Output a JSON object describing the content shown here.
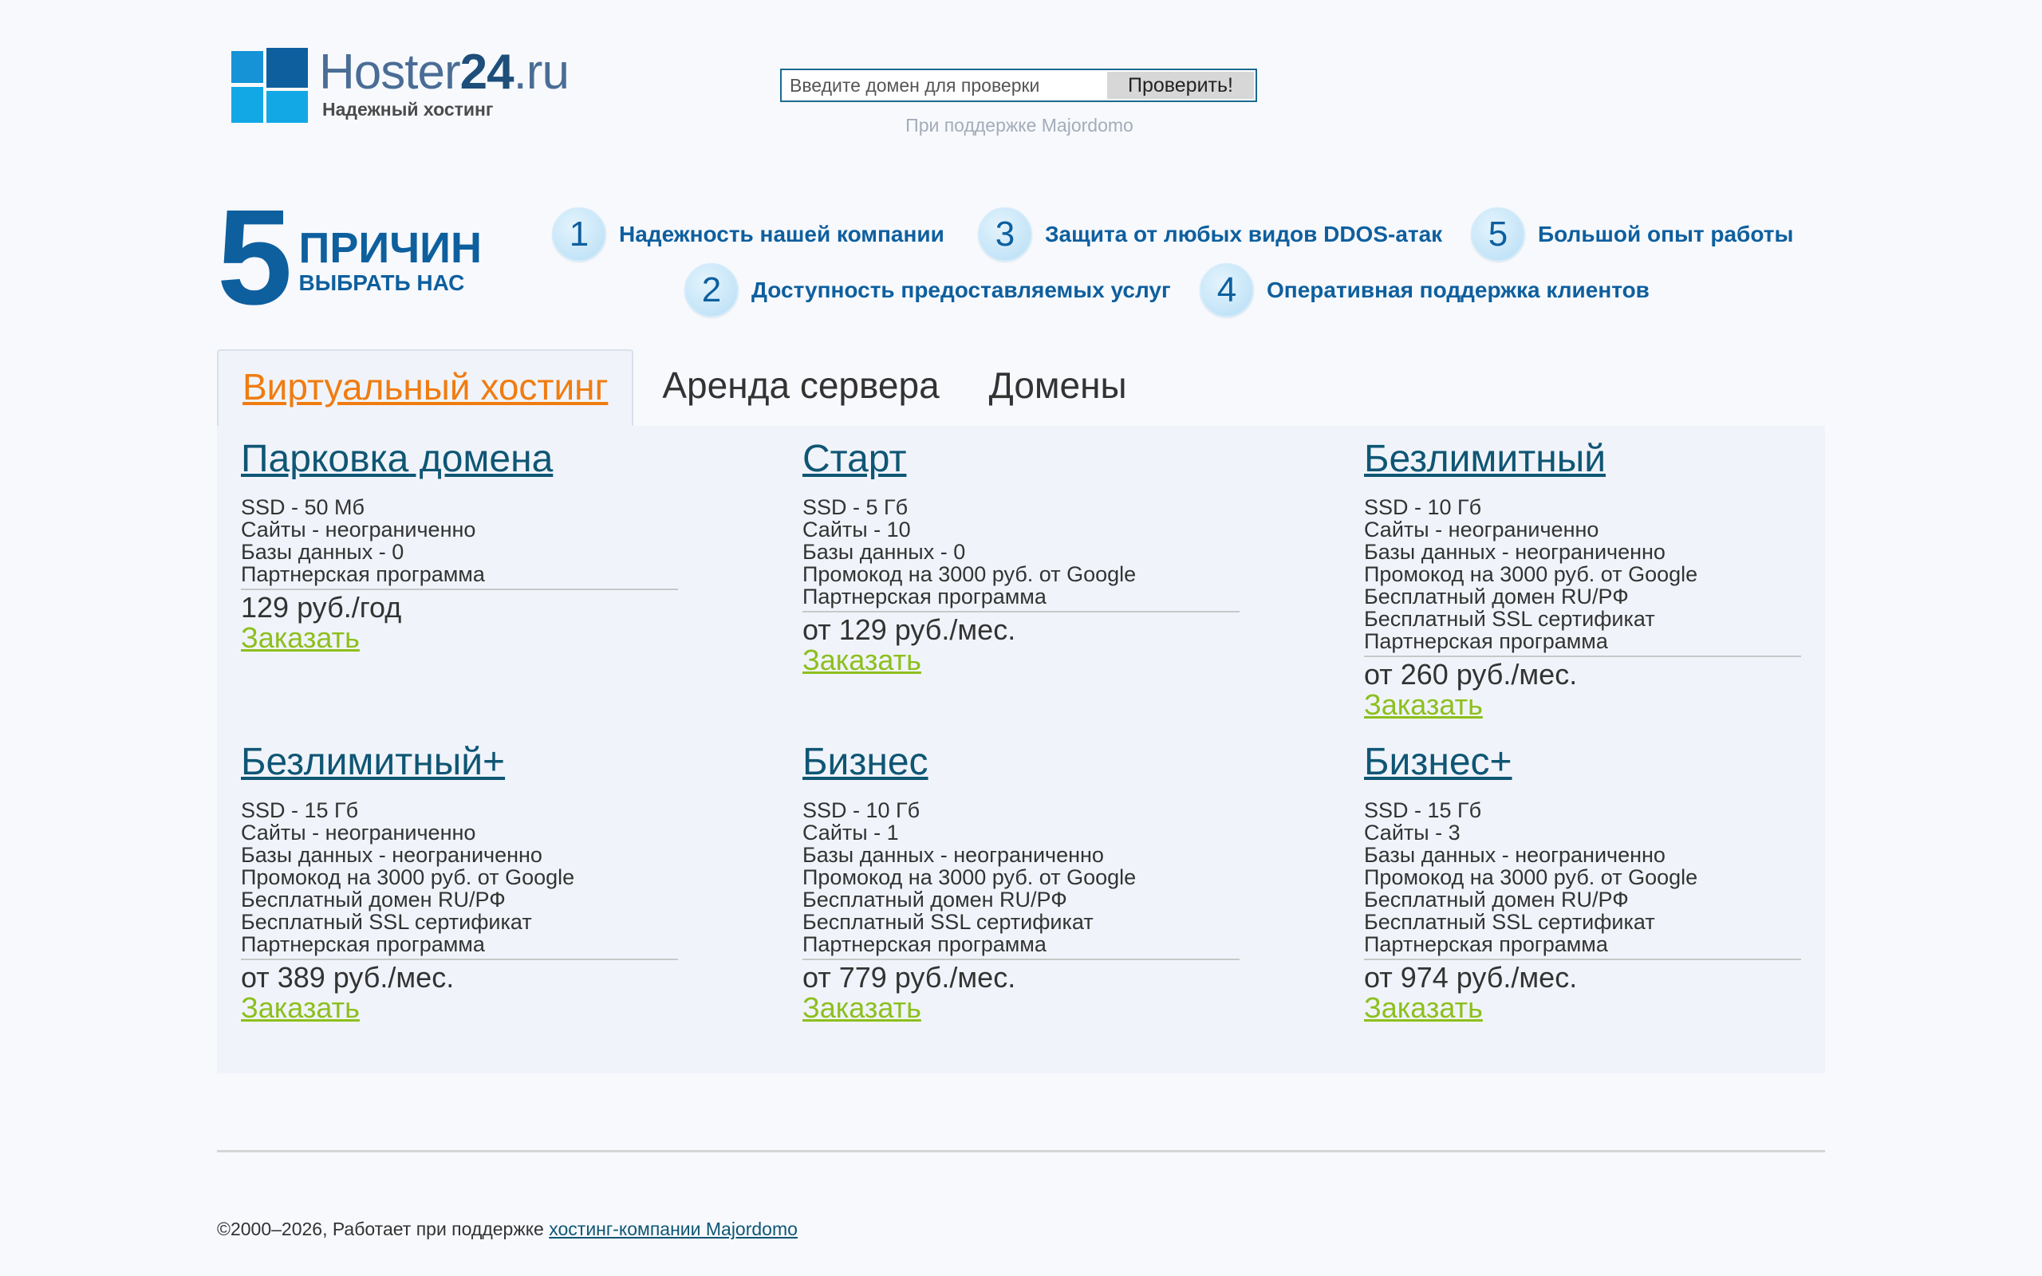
{
  "header": {
    "logo_name": "Hoster",
    "logo_num": "24",
    "logo_tld": ".ru",
    "logo_tagline": "Надежный хостинг",
    "search_placeholder": "Введите домен для проверки",
    "search_button": "Проверить!",
    "support_note": "При поддержке Majordomo"
  },
  "reasons": {
    "big_number": "5",
    "title_line1": "ПРИЧИН",
    "title_line2": "ВЫБРАТЬ НАС",
    "items": [
      {
        "num": "1",
        "text": "Надежность нашей компании"
      },
      {
        "num": "2",
        "text": "Доступность предоставляемых услуг"
      },
      {
        "num": "3",
        "text": "Защита от любых видов DDOS-атак"
      },
      {
        "num": "4",
        "text": "Оперативная поддержка клиентов"
      },
      {
        "num": "5",
        "text": "Большой опыт работы"
      }
    ]
  },
  "tabs": [
    {
      "label": "Виртуальный хостинг",
      "active": true
    },
    {
      "label": "Аренда сервера",
      "active": false
    },
    {
      "label": "Домены",
      "active": false
    }
  ],
  "plans": [
    {
      "name": "Парковка домена",
      "features": [
        "SSD - 50 Мб",
        "Сайты - неограниченно",
        "Базы данных - 0",
        "Партнерская программа"
      ],
      "price": "129 руб./год",
      "order": "Заказать"
    },
    {
      "name": "Старт",
      "features": [
        "SSD - 5 Гб",
        "Сайты - 10",
        "Базы данных - 0",
        "Промокод на 3000 руб. от Google",
        "Партнерская программа"
      ],
      "price": "от 129 руб./мес.",
      "order": "Заказать"
    },
    {
      "name": "Безлимитный",
      "features": [
        "SSD - 10 Гб",
        "Сайты - неограниченно",
        "Базы данных - неограниченно",
        "Промокод на 3000 руб. от Google",
        "Бесплатный домен RU/РФ",
        "Бесплатный SSL сертификат",
        "Партнерская программа"
      ],
      "price": "от 260 руб./мес.",
      "order": "Заказать"
    },
    {
      "name": "Безлимитный+",
      "features": [
        "SSD - 15 Гб",
        "Сайты - неограниченно",
        "Базы данных - неограниченно",
        "Промокод на 3000 руб. от Google",
        "Бесплатный домен RU/РФ",
        "Бесплатный SSL сертификат",
        "Партнерская программа"
      ],
      "price": "от 389 руб./мес.",
      "order": "Заказать"
    },
    {
      "name": "Бизнес",
      "features": [
        "SSD - 10 Гб",
        "Сайты - 1",
        "Базы данных - неограниченно",
        "Промокод на 3000 руб. от Google",
        "Бесплатный домен RU/РФ",
        "Бесплатный SSL сертификат",
        "Партнерская программа"
      ],
      "price": "от 779 руб./мес.",
      "order": "Заказать"
    },
    {
      "name": "Бизнес+",
      "features": [
        "SSD - 15 Гб",
        "Сайты - 3",
        "Базы данных - неограниченно",
        "Промокод на 3000 руб. от Google",
        "Бесплатный домен RU/РФ",
        "Бесплатный SSL сертификат",
        "Партнерская программа"
      ],
      "price": "от 974 руб./мес.",
      "order": "Заказать"
    }
  ],
  "footer": {
    "text": "©2000–2026, Работает при поддержке ",
    "link": "хостинг-компании Majordomo"
  },
  "colors": {
    "brand_blue": "#0e5f9e",
    "plan_title": "#0f5674",
    "active_tab": "#f07c11",
    "order_link": "#8dbf1e",
    "panel_bg": "#f0f4fa"
  }
}
